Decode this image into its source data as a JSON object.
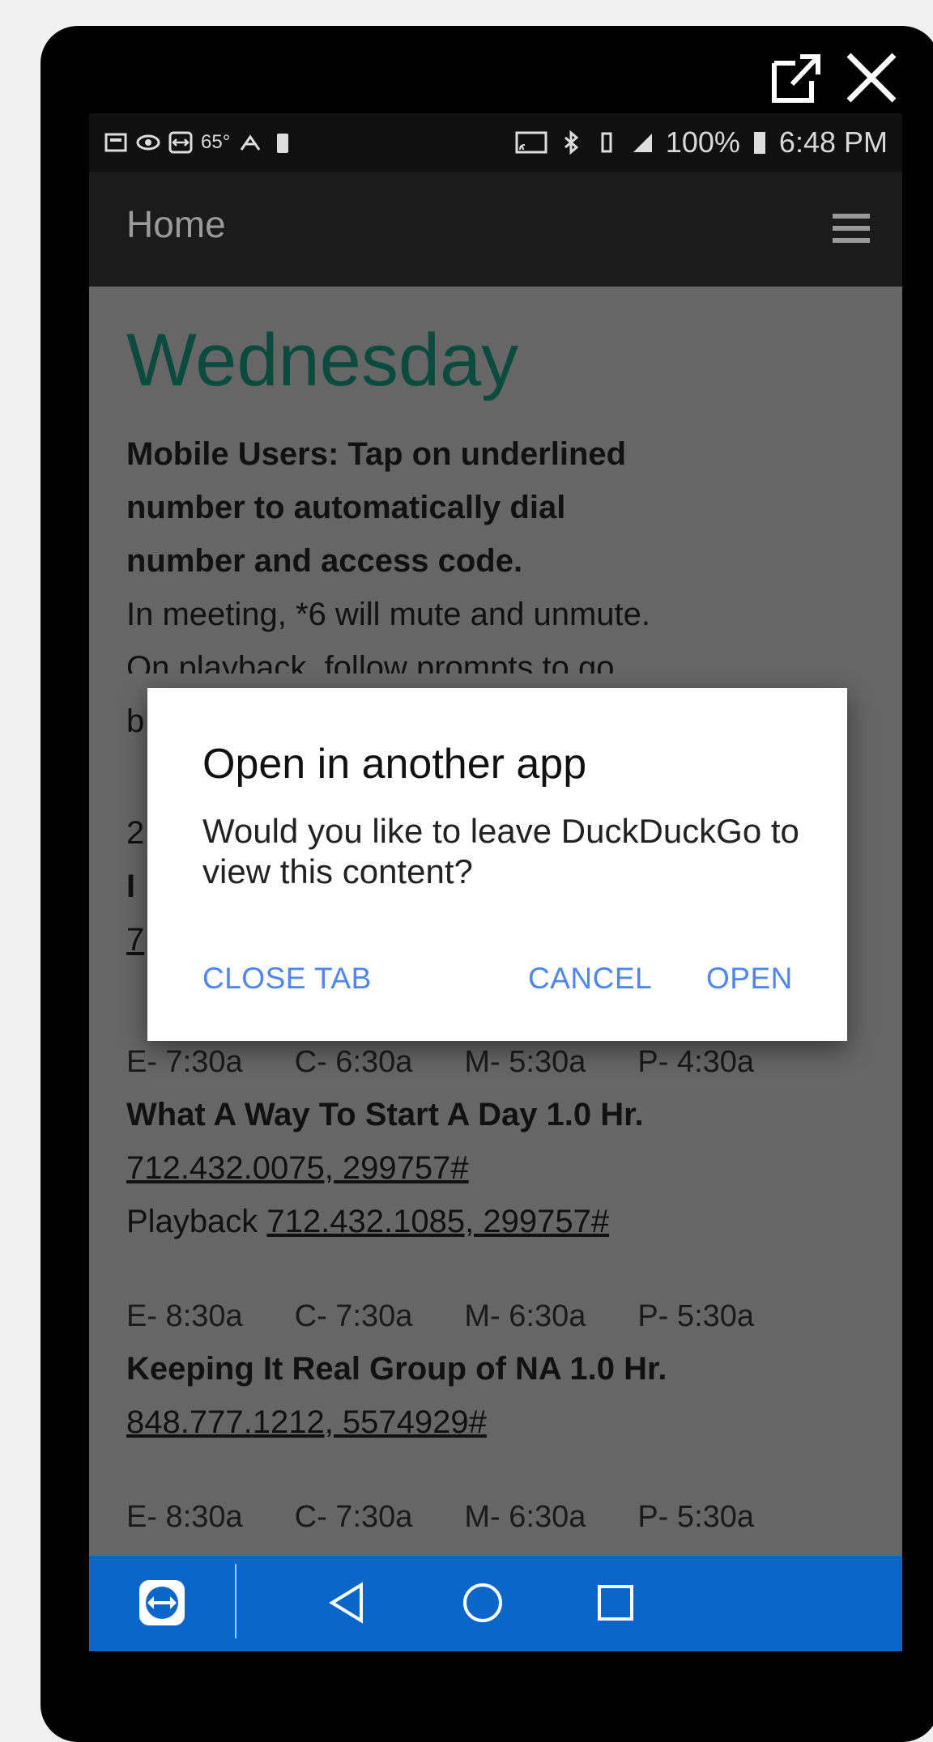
{
  "window_controls": {
    "popout_icon": "external-link-icon",
    "close_icon": "close-icon"
  },
  "status_bar": {
    "temperature": "65°",
    "battery_percent": "100%",
    "time": "6:48 PM"
  },
  "app_bar": {
    "title": "Home",
    "menu_icon": "hamburger-menu-icon"
  },
  "page": {
    "heading": "Wednesday",
    "bold_lines": [
      "Mobile Users: Tap on underlined",
      "number to automatically dial",
      "number and access code."
    ],
    "note": "In meeting, *6 will mute and unmute.",
    "partial_line": "On playback, follow prompts to go",
    "partial_b": "b",
    "partial_2": "2",
    "partial_I": "I",
    "partial_7": "7"
  },
  "schedule": [
    {
      "times": [
        "E- 7:30a",
        "C- 6:30a",
        "M- 5:30a",
        "P- 4:30a"
      ],
      "title": "What A Way To Start A Day 1.0 Hr.",
      "number": "712.432.0075, 299757#",
      "playback_label": "Playback ",
      "playback_number": "712.432.1085, 299757#"
    },
    {
      "times": [
        "E- 8:30a",
        "C- 7:30a",
        "M- 6:30a",
        "P- 5:30a"
      ],
      "title": "Keeping It Real Group of NA 1.0 Hr.",
      "number": "848.777.1212, 5574929#"
    },
    {
      "times": [
        "E- 8:30a",
        "C- 7:30a",
        "M- 6:30a",
        "P- 5:30a"
      ]
    }
  ],
  "dialog": {
    "title": "Open in another app",
    "message": "Would you like to leave DuckDuckGo to view this content?",
    "close_tab": "CLOSE TAB",
    "cancel": "CANCEL",
    "open": "OPEN"
  },
  "nav_bar": {
    "teamviewer_icon": "teamviewer-icon",
    "back_icon": "back-triangle-icon",
    "home_icon": "home-circle-icon",
    "recents_icon": "recents-square-icon"
  },
  "colors": {
    "heading": "#0b4a3f",
    "dialog_button": "#4f86ec",
    "nav_bar": "#0a67c9",
    "dim_background": "#666666"
  }
}
